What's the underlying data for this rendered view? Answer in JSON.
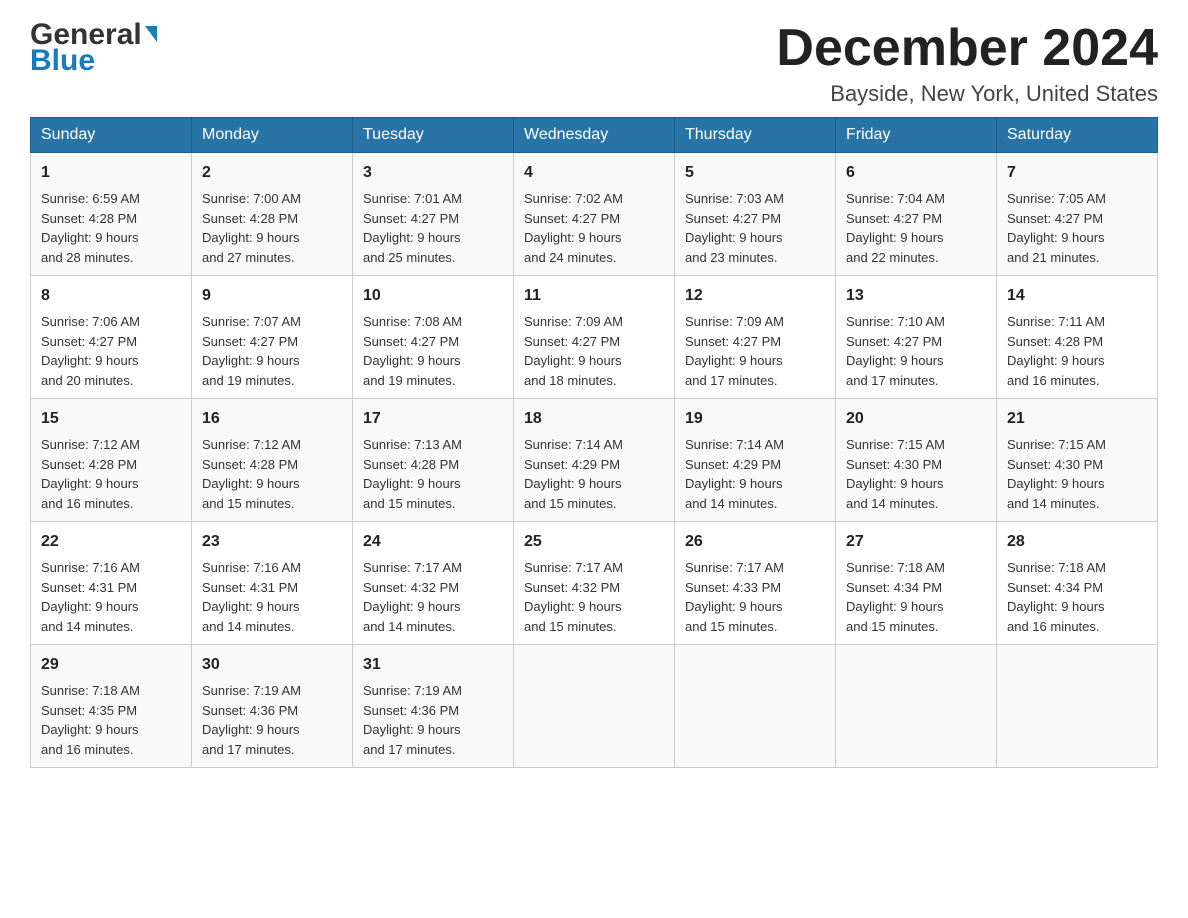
{
  "header": {
    "logo_general": "General",
    "logo_blue": "Blue",
    "title": "December 2024",
    "subtitle": "Bayside, New York, United States"
  },
  "weekdays": [
    "Sunday",
    "Monday",
    "Tuesday",
    "Wednesday",
    "Thursday",
    "Friday",
    "Saturday"
  ],
  "weeks": [
    [
      {
        "day": "1",
        "sunrise": "Sunrise: 6:59 AM",
        "sunset": "Sunset: 4:28 PM",
        "daylight": "Daylight: 9 hours",
        "daylight2": "and 28 minutes."
      },
      {
        "day": "2",
        "sunrise": "Sunrise: 7:00 AM",
        "sunset": "Sunset: 4:28 PM",
        "daylight": "Daylight: 9 hours",
        "daylight2": "and 27 minutes."
      },
      {
        "day": "3",
        "sunrise": "Sunrise: 7:01 AM",
        "sunset": "Sunset: 4:27 PM",
        "daylight": "Daylight: 9 hours",
        "daylight2": "and 25 minutes."
      },
      {
        "day": "4",
        "sunrise": "Sunrise: 7:02 AM",
        "sunset": "Sunset: 4:27 PM",
        "daylight": "Daylight: 9 hours",
        "daylight2": "and 24 minutes."
      },
      {
        "day": "5",
        "sunrise": "Sunrise: 7:03 AM",
        "sunset": "Sunset: 4:27 PM",
        "daylight": "Daylight: 9 hours",
        "daylight2": "and 23 minutes."
      },
      {
        "day": "6",
        "sunrise": "Sunrise: 7:04 AM",
        "sunset": "Sunset: 4:27 PM",
        "daylight": "Daylight: 9 hours",
        "daylight2": "and 22 minutes."
      },
      {
        "day": "7",
        "sunrise": "Sunrise: 7:05 AM",
        "sunset": "Sunset: 4:27 PM",
        "daylight": "Daylight: 9 hours",
        "daylight2": "and 21 minutes."
      }
    ],
    [
      {
        "day": "8",
        "sunrise": "Sunrise: 7:06 AM",
        "sunset": "Sunset: 4:27 PM",
        "daylight": "Daylight: 9 hours",
        "daylight2": "and 20 minutes."
      },
      {
        "day": "9",
        "sunrise": "Sunrise: 7:07 AM",
        "sunset": "Sunset: 4:27 PM",
        "daylight": "Daylight: 9 hours",
        "daylight2": "and 19 minutes."
      },
      {
        "day": "10",
        "sunrise": "Sunrise: 7:08 AM",
        "sunset": "Sunset: 4:27 PM",
        "daylight": "Daylight: 9 hours",
        "daylight2": "and 19 minutes."
      },
      {
        "day": "11",
        "sunrise": "Sunrise: 7:09 AM",
        "sunset": "Sunset: 4:27 PM",
        "daylight": "Daylight: 9 hours",
        "daylight2": "and 18 minutes."
      },
      {
        "day": "12",
        "sunrise": "Sunrise: 7:09 AM",
        "sunset": "Sunset: 4:27 PM",
        "daylight": "Daylight: 9 hours",
        "daylight2": "and 17 minutes."
      },
      {
        "day": "13",
        "sunrise": "Sunrise: 7:10 AM",
        "sunset": "Sunset: 4:27 PM",
        "daylight": "Daylight: 9 hours",
        "daylight2": "and 17 minutes."
      },
      {
        "day": "14",
        "sunrise": "Sunrise: 7:11 AM",
        "sunset": "Sunset: 4:28 PM",
        "daylight": "Daylight: 9 hours",
        "daylight2": "and 16 minutes."
      }
    ],
    [
      {
        "day": "15",
        "sunrise": "Sunrise: 7:12 AM",
        "sunset": "Sunset: 4:28 PM",
        "daylight": "Daylight: 9 hours",
        "daylight2": "and 16 minutes."
      },
      {
        "day": "16",
        "sunrise": "Sunrise: 7:12 AM",
        "sunset": "Sunset: 4:28 PM",
        "daylight": "Daylight: 9 hours",
        "daylight2": "and 15 minutes."
      },
      {
        "day": "17",
        "sunrise": "Sunrise: 7:13 AM",
        "sunset": "Sunset: 4:28 PM",
        "daylight": "Daylight: 9 hours",
        "daylight2": "and 15 minutes."
      },
      {
        "day": "18",
        "sunrise": "Sunrise: 7:14 AM",
        "sunset": "Sunset: 4:29 PM",
        "daylight": "Daylight: 9 hours",
        "daylight2": "and 15 minutes."
      },
      {
        "day": "19",
        "sunrise": "Sunrise: 7:14 AM",
        "sunset": "Sunset: 4:29 PM",
        "daylight": "Daylight: 9 hours",
        "daylight2": "and 14 minutes."
      },
      {
        "day": "20",
        "sunrise": "Sunrise: 7:15 AM",
        "sunset": "Sunset: 4:30 PM",
        "daylight": "Daylight: 9 hours",
        "daylight2": "and 14 minutes."
      },
      {
        "day": "21",
        "sunrise": "Sunrise: 7:15 AM",
        "sunset": "Sunset: 4:30 PM",
        "daylight": "Daylight: 9 hours",
        "daylight2": "and 14 minutes."
      }
    ],
    [
      {
        "day": "22",
        "sunrise": "Sunrise: 7:16 AM",
        "sunset": "Sunset: 4:31 PM",
        "daylight": "Daylight: 9 hours",
        "daylight2": "and 14 minutes."
      },
      {
        "day": "23",
        "sunrise": "Sunrise: 7:16 AM",
        "sunset": "Sunset: 4:31 PM",
        "daylight": "Daylight: 9 hours",
        "daylight2": "and 14 minutes."
      },
      {
        "day": "24",
        "sunrise": "Sunrise: 7:17 AM",
        "sunset": "Sunset: 4:32 PM",
        "daylight": "Daylight: 9 hours",
        "daylight2": "and 14 minutes."
      },
      {
        "day": "25",
        "sunrise": "Sunrise: 7:17 AM",
        "sunset": "Sunset: 4:32 PM",
        "daylight": "Daylight: 9 hours",
        "daylight2": "and 15 minutes."
      },
      {
        "day": "26",
        "sunrise": "Sunrise: 7:17 AM",
        "sunset": "Sunset: 4:33 PM",
        "daylight": "Daylight: 9 hours",
        "daylight2": "and 15 minutes."
      },
      {
        "day": "27",
        "sunrise": "Sunrise: 7:18 AM",
        "sunset": "Sunset: 4:34 PM",
        "daylight": "Daylight: 9 hours",
        "daylight2": "and 15 minutes."
      },
      {
        "day": "28",
        "sunrise": "Sunrise: 7:18 AM",
        "sunset": "Sunset: 4:34 PM",
        "daylight": "Daylight: 9 hours",
        "daylight2": "and 16 minutes."
      }
    ],
    [
      {
        "day": "29",
        "sunrise": "Sunrise: 7:18 AM",
        "sunset": "Sunset: 4:35 PM",
        "daylight": "Daylight: 9 hours",
        "daylight2": "and 16 minutes."
      },
      {
        "day": "30",
        "sunrise": "Sunrise: 7:19 AM",
        "sunset": "Sunset: 4:36 PM",
        "daylight": "Daylight: 9 hours",
        "daylight2": "and 17 minutes."
      },
      {
        "day": "31",
        "sunrise": "Sunrise: 7:19 AM",
        "sunset": "Sunset: 4:36 PM",
        "daylight": "Daylight: 9 hours",
        "daylight2": "and 17 minutes."
      },
      null,
      null,
      null,
      null
    ]
  ]
}
